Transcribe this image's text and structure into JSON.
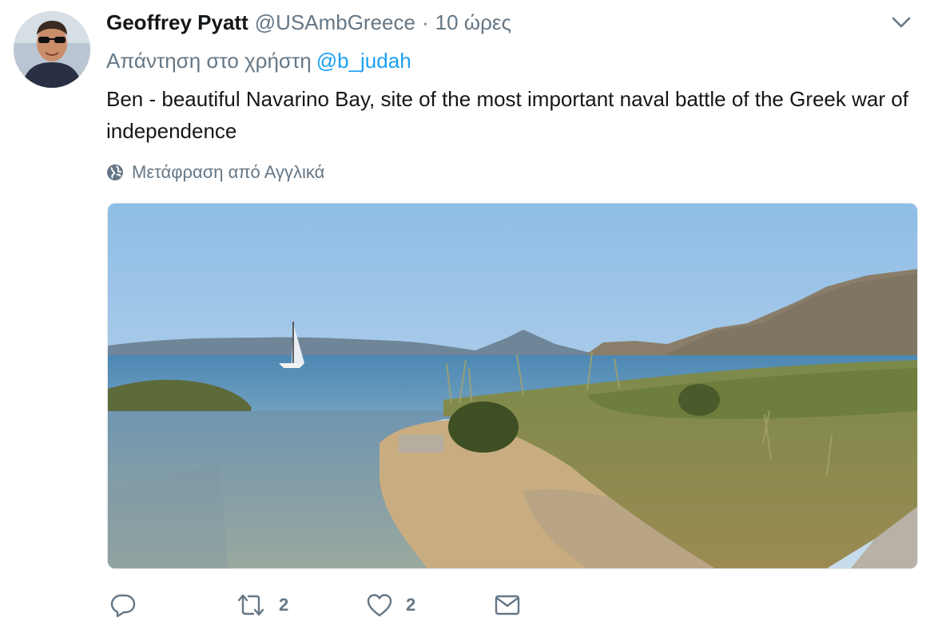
{
  "tweet": {
    "author_name": "Geoffrey Pyatt",
    "author_handle": "@USAmbGreece",
    "separator": "·",
    "timestamp": "10 ώρες",
    "reply_prefix": "Απάντηση στο χρήστη",
    "reply_mention": "@b_judah",
    "text": "Ben - beautiful Navarino Bay, site of the most important naval battle of the Greek war of independence",
    "translate_label": "Μετάφραση από Αγγλικά",
    "media": {
      "description": "photo"
    },
    "actions": {
      "reply_icon": "reply-icon",
      "retweet_icon": "retweet-icon",
      "retweet_count": "2",
      "like_icon": "heart-icon",
      "like_count": "2",
      "dm_icon": "envelope-icon"
    }
  },
  "colors": {
    "link": "#1da1f2",
    "secondary": "#657786",
    "primary_text": "#14171a"
  }
}
